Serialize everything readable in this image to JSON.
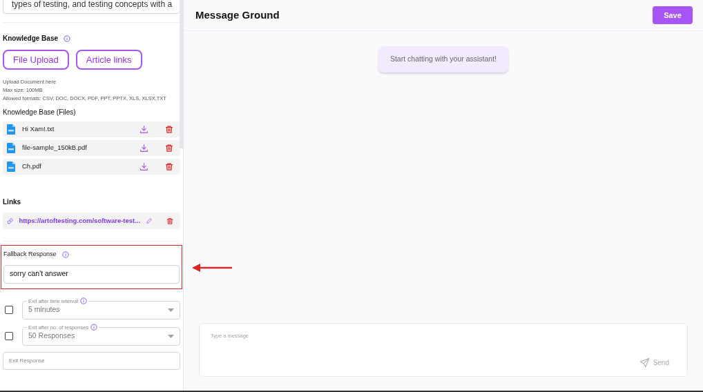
{
  "description": {
    "value": "types of testing, and testing concepts with a"
  },
  "knowledge_base": {
    "title": "Knowledge Base",
    "buttons": [
      {
        "label": "File Upload"
      },
      {
        "label": "Article links"
      }
    ],
    "hints": [
      "Upload Document here",
      "Max size: 100MB",
      "Allowed formats: CSV, DOC, DOCX, PDF, PPT, PPTX, XLS, XLSX,TXT"
    ]
  },
  "files": {
    "title": "Knowledge Base (Files)",
    "items": [
      {
        "name": "Hi Xam!.txt"
      },
      {
        "name": "file-sample_150kB.pdf"
      },
      {
        "name": "Ch.pdf"
      }
    ]
  },
  "links": {
    "title": "Links",
    "items": [
      {
        "url": "https://artoftesting.com/software-test..."
      }
    ]
  },
  "fallback": {
    "title": "Fallback Response",
    "value": "sorry can't answer",
    "highlighted": true
  },
  "exit_options": [
    {
      "label": "Exit after time interval",
      "value": "5 minutes",
      "checked": false
    },
    {
      "label": "Exit after no. of responses",
      "value": "50 Responses",
      "checked": false
    }
  ],
  "exit_response": {
    "placeholder": "Exit Response"
  },
  "main": {
    "title": "Message Ground",
    "save": "Save",
    "empty_message": "Start chatting with your assistant!",
    "composer": {
      "placeholder": "Type a message",
      "send": "Send"
    }
  }
}
